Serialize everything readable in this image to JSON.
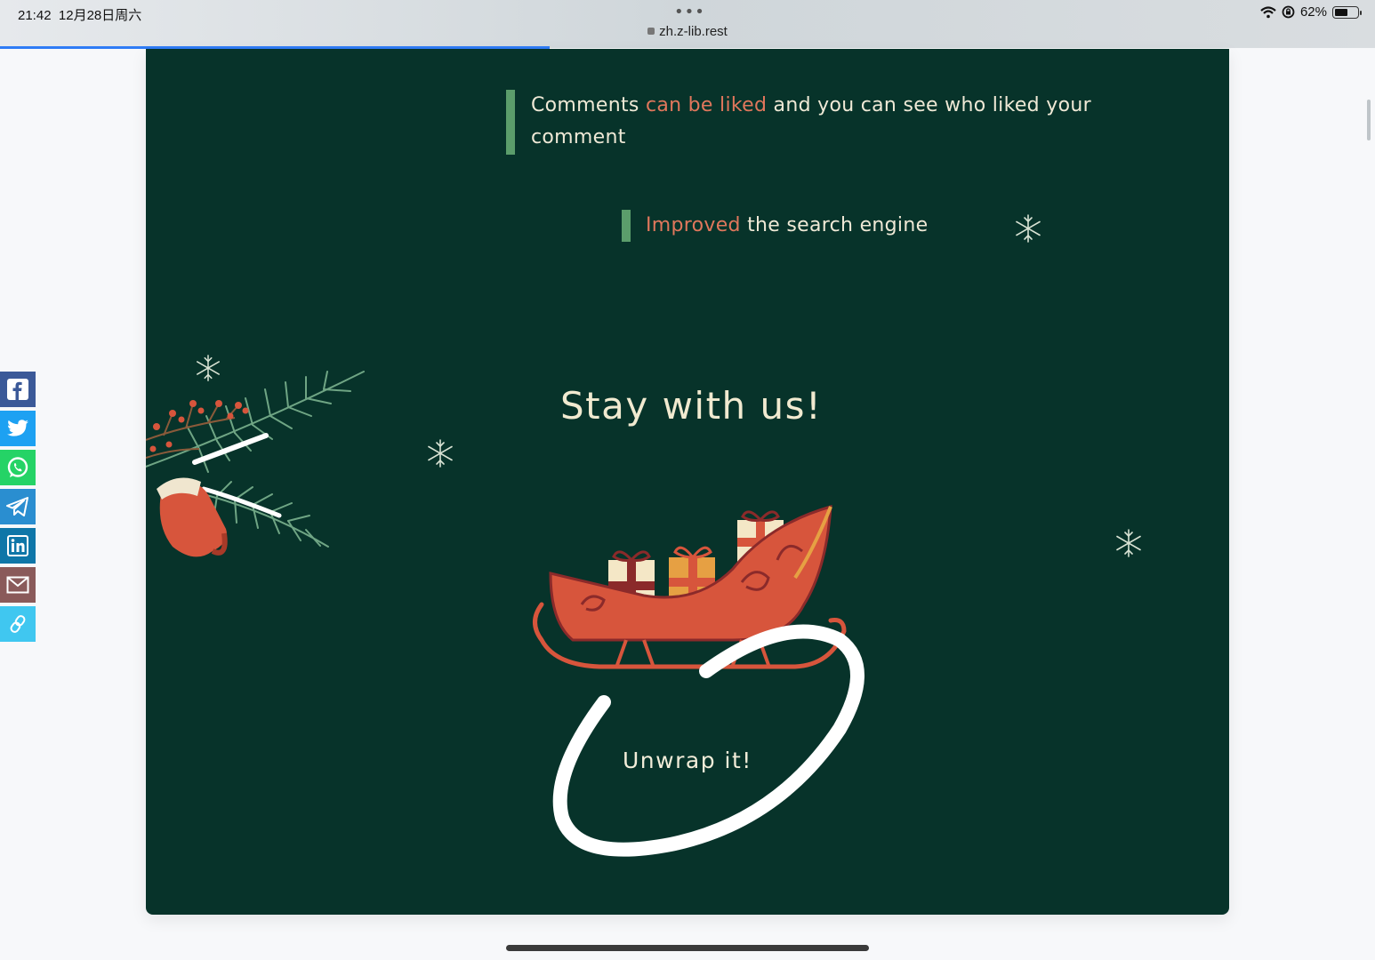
{
  "status_bar": {
    "time": "21:42",
    "date": "12月28日周六",
    "dots": "•••",
    "url": "zh.z-lib.rest",
    "battery": "62%",
    "battery_level": 0.62
  },
  "page_load_progress": 0.4,
  "features": [
    {
      "before": "Comments ",
      "highlight": "can be liked",
      "after": " and you can see who liked your comment"
    },
    {
      "before": "",
      "highlight": "Improved",
      "after": " the search engine"
    }
  ],
  "headline": "Stay with us!",
  "cta": "Unwrap it!",
  "share_buttons": [
    {
      "name": "facebook",
      "color": "#3b5998"
    },
    {
      "name": "twitter",
      "color": "#1da1f2"
    },
    {
      "name": "whatsapp",
      "color": "#25d366"
    },
    {
      "name": "telegram",
      "color": "#2a8ed0"
    },
    {
      "name": "linkedin",
      "color": "#0e76a8"
    },
    {
      "name": "email",
      "color": "#8a5a5a"
    },
    {
      "name": "copy-link",
      "color": "#40c7f0"
    }
  ],
  "colors": {
    "background": "#07332a",
    "highlight": "#e0775c",
    "text": "#efe9d6",
    "accent_bar": "#5b9d6b",
    "sleigh": "#d7553c"
  }
}
